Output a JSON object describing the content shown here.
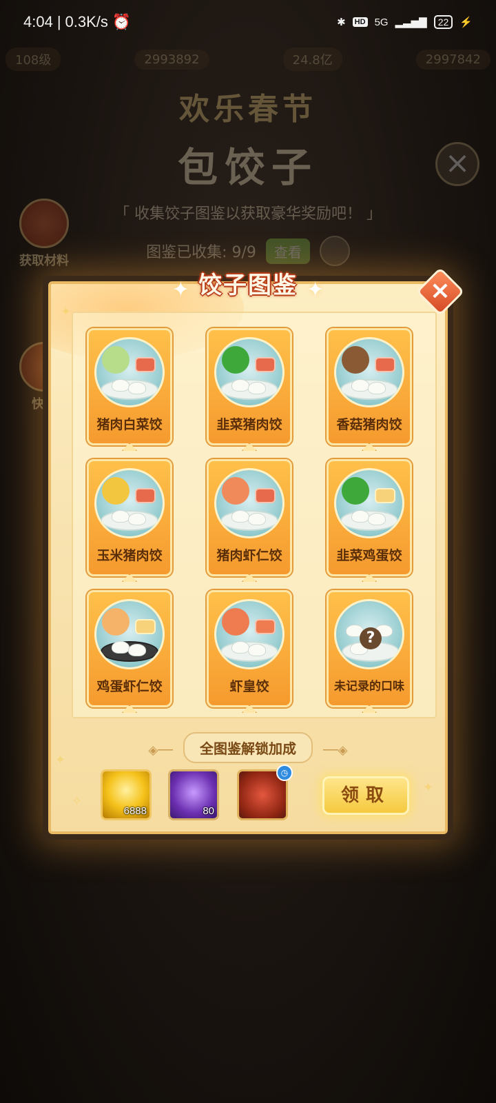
{
  "status_bar": {
    "time": "4:04",
    "speed": "0.3K/s",
    "network": "5G",
    "hd_badge": "HD",
    "battery": "22"
  },
  "background": {
    "level": "108级",
    "resource_1": "2993892",
    "resource_2": "24.8亿",
    "resource_3": "2997842",
    "event_title": "欢乐春节",
    "game_title": "包饺子",
    "slogan": "收集饺子图鉴以获取豪华奖励吧！",
    "collected_label": "图鉴已收集: 9/9",
    "view_button": "查看",
    "side_buttons": [
      "获取材料",
      "快捷"
    ]
  },
  "modal": {
    "title": "饺子图鉴",
    "close_icon": "close-icon",
    "dumplings": [
      {
        "name": "猪肉白菜饺",
        "veg_color": "#b7dc8a"
      },
      {
        "name": "韭菜猪肉饺",
        "veg_color": "#3fa83a"
      },
      {
        "name": "香菇猪肉饺",
        "veg_color": "#8a5a34"
      },
      {
        "name": "玉米猪肉饺",
        "veg_color": "#f3c640"
      },
      {
        "name": "猪肉虾仁饺",
        "veg_color": "#f08a5a"
      },
      {
        "name": "韭菜鸡蛋饺",
        "veg_color": "#3fa83a"
      },
      {
        "name": "鸡蛋虾仁饺",
        "veg_color": "#f5b36a"
      },
      {
        "name": "虾皇饺",
        "veg_color": "#ef7c50"
      },
      {
        "name": "未记录的口味",
        "veg_color": ""
      }
    ],
    "unlock_title": "全图鉴解锁加成",
    "rewards": [
      {
        "icon": "gold-ingot-icon",
        "qty": "6888"
      },
      {
        "icon": "purple-avatar-frame-icon",
        "qty": "80"
      },
      {
        "icon": "red-chest-icon",
        "qty": ""
      }
    ],
    "claim_button": "领取"
  },
  "colors": {
    "card_orange": "#f59a2e",
    "modal_cream": "#fdeec3",
    "title_red": "#b23a18",
    "claim_yellow": "#f5c93e"
  }
}
